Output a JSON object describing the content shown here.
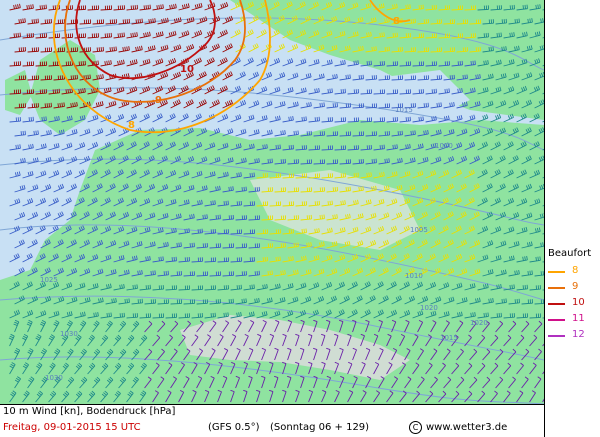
{
  "map": {
    "isobar_labels": [
      {
        "text": "1015"
      },
      {
        "text": "1010"
      },
      {
        "text": "1005"
      },
      {
        "text": "1010"
      },
      {
        "text": "1015"
      },
      {
        "text": "1020"
      },
      {
        "text": "1025"
      },
      {
        "text": "1030"
      },
      {
        "text": "1020"
      },
      {
        "text": "1030"
      }
    ],
    "beaufort_contour_labels": [
      "10",
      "9",
      "8",
      "8"
    ]
  },
  "legend": {
    "title": "Beaufort",
    "items": [
      {
        "label": "8",
        "color": "#ffa500"
      },
      {
        "label": "9",
        "color": "#e8700a"
      },
      {
        "label": "10",
        "color": "#c01010"
      },
      {
        "label": "11",
        "color": "#d0108a"
      },
      {
        "label": "12",
        "color": "#b030c0"
      }
    ]
  },
  "footer": {
    "title": "10 m Wind [kn], Bodendruck [hPa]",
    "date": "Freitag, 09-01-2015   15 UTC",
    "model": "(GFS 0.5°)",
    "run": "(Sonntag 06 + 129)",
    "copyright_symbol": "C",
    "site": "www.wetter3.de"
  },
  "colors": {
    "sea": "#c8e0f4",
    "land": "#8fe3a0",
    "mountains": "#dcdcdc",
    "barb_yellow": "#e8e000",
    "barb_teal": "#1f8a8a",
    "barb_blue": "#3a5fc8",
    "barb_purple": "#6a1fa8",
    "barb_red": "#9a0a0a",
    "isobar": "#7fa6d6"
  }
}
